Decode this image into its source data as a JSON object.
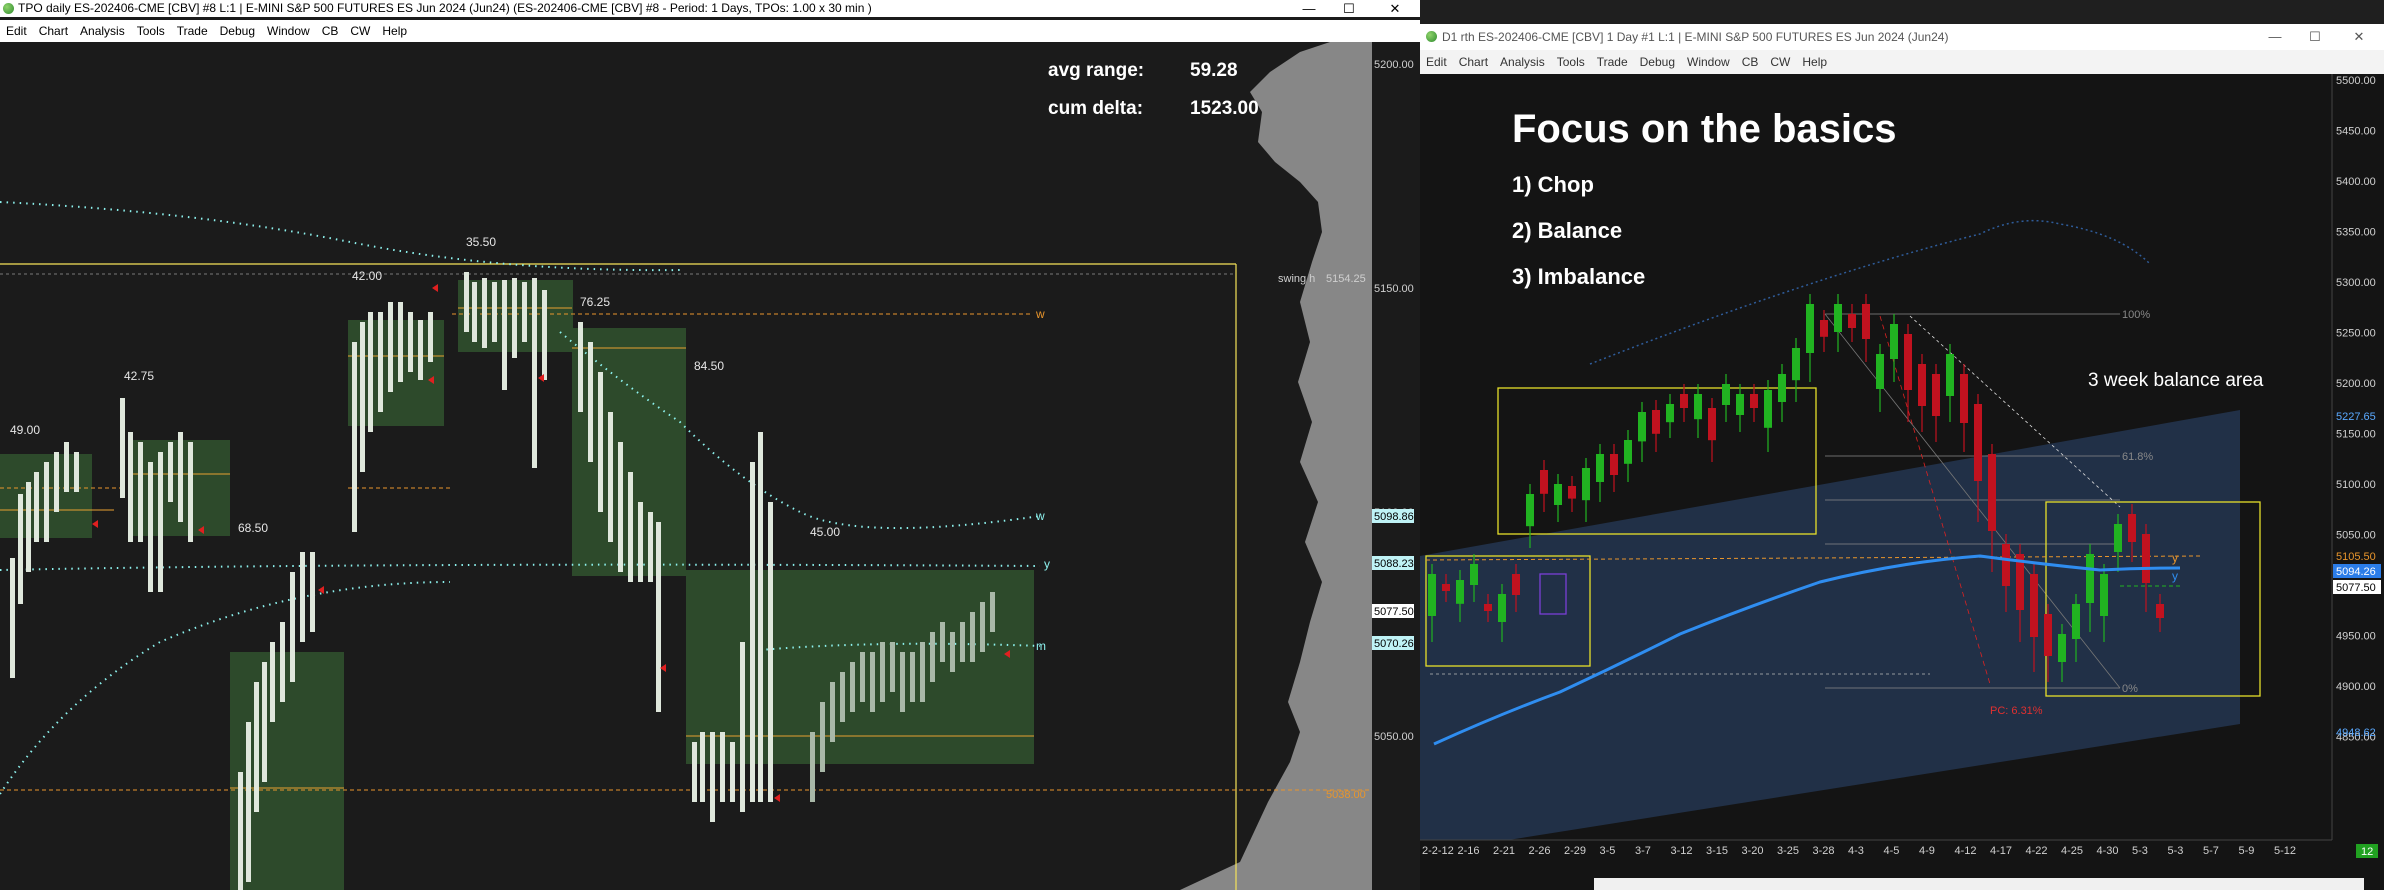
{
  "left_window": {
    "title": "TPO daily ES-202406-CME [CBV] #8 L:1 | E-MINI S&P 500 FUTURES ES Jun 2024 (Jun24) (ES-202406-CME [CBV] #8 - Period: 1 Days, TPOs: 1.00 x 30 min )",
    "menu": [
      "Edit",
      "Chart",
      "Analysis",
      "Tools",
      "Trade",
      "Debug",
      "Window",
      "CB",
      "CW",
      "Help"
    ],
    "window_controls": {
      "min": "—",
      "max": "☐",
      "close": "✕"
    },
    "stats": {
      "avg_range_label": "avg range:",
      "avg_range_value": "59.28",
      "cum_delta_label": "cum delta:",
      "cum_delta_value": "1523.00"
    },
    "price_axis": [
      "5200.00",
      "5150.00",
      "5100.00",
      "5050.00"
    ],
    "price_tags": [
      {
        "text": "5098.86",
        "bg": "#bff3f6"
      },
      {
        "text": "5088.23",
        "bg": "#bff3f6"
      },
      {
        "text": "5077.50",
        "bg": "#ffffff"
      },
      {
        "text": "5070.26",
        "bg": "#bff3f6"
      }
    ],
    "level_labels": {
      "swing_h": "swing h",
      "swing_h_price": "5154.25",
      "low_price": "5038.00"
    },
    "range_labels": [
      "49.00",
      "42.75",
      "68.50",
      "42.00",
      "35.50",
      "76.25",
      "84.50",
      "45.00"
    ],
    "line_tags": {
      "w_upper": "w",
      "w": "w",
      "y": "y",
      "m": "m"
    },
    "colors": {
      "background": "#1b1b1b",
      "value_area": "#2c4a2c",
      "guide": "#f5e35a",
      "poc": "#e8952c",
      "vwap": "#8df2ee",
      "tpo": "#dfe7dc"
    }
  },
  "right_window": {
    "title": "D1 rth ES-202406-CME [CBV]  1 Day  #1 L:1 | E-MINI S&P 500 FUTURES ES Jun 2024 (Jun24)",
    "menu": [
      "Edit",
      "Chart",
      "Analysis",
      "Tools",
      "Trade",
      "Debug",
      "Window",
      "CB",
      "CW",
      "Help"
    ],
    "window_controls": {
      "min": "—",
      "max": "☐",
      "close": "✕"
    },
    "headline": "Focus on the basics",
    "points": [
      "1)  Chop",
      "2)  Balance",
      "3)  Imbalance"
    ],
    "annotation": "3 week balance area",
    "fib_labels": {
      "top": "100%",
      "mid": "61.8%",
      "pc": "PC: 6.31%",
      "zero": "0%"
    },
    "price_axis": [
      "5500.00",
      "5450.00",
      "5400.00",
      "5350.00",
      "5300.00",
      "5250.00",
      "5200.00",
      "5150.00",
      "5100.00",
      "5050.00",
      "5000.00",
      "4950.00",
      "4900.00",
      "4850.00"
    ],
    "price_tags": [
      {
        "text": "5227.65",
        "fg": "#5aa9ff"
      },
      {
        "text": "5105.50",
        "fg": "#e8952c"
      },
      {
        "text": "5094.26",
        "fg": "#ffffff",
        "bg": "#2b7de9"
      },
      {
        "text": "5077.50",
        "fg": "#000000",
        "bg": "#ffffff"
      },
      {
        "text": "4948.62",
        "fg": "#5aa9ff"
      }
    ],
    "date_axis": [
      "2-2-12",
      "2-16",
      "2-21",
      "2-26",
      "2-29",
      "3-5",
      "3-7",
      "3-12",
      "3-15",
      "3-20",
      "3-25",
      "3-28",
      "4-3",
      "4-5",
      "4-9",
      "4-12",
      "4-17",
      "4-22",
      "4-25",
      "4-30",
      "5-3",
      "5-3",
      "5-7",
      "5-9",
      "5-12"
    ],
    "corner_badge": "12",
    "line_tags": {
      "y1": "y",
      "y2": "y"
    },
    "colors": {
      "background": "#141414",
      "bull": "#21b321",
      "bear": "#c1121f",
      "ma": "#2f8df0",
      "box": "#e6e02a",
      "zone": "#25344a"
    }
  }
}
